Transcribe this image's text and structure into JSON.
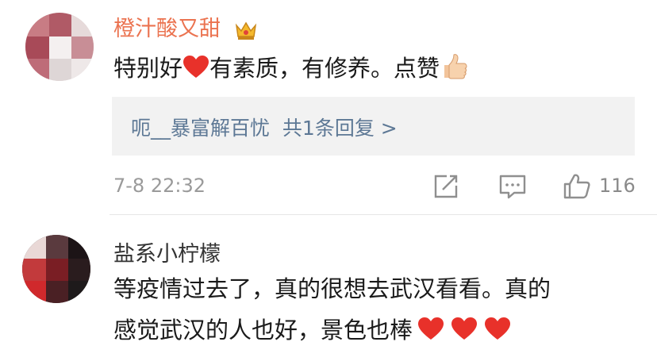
{
  "comments": [
    {
      "username": "橙汁酸又甜",
      "has_crown_badge": true,
      "text_before": "特别好",
      "text_after": "有素质，有修养。点赞",
      "reply": {
        "user": "呃__暴富解百忧",
        "summary": "共1条回复 >"
      },
      "timestamp": "7-8 22:32",
      "like_count": "116"
    },
    {
      "username": "盐系小柠檬",
      "line1": "等疫情过去了，真的很想去武汉看看。真的",
      "line2": "感觉武汉的人也好，景色也棒"
    }
  ],
  "colors": {
    "username_highlight": "#eb7350",
    "reply_link": "#5d7895",
    "heart": "#e8312a",
    "meta_gray": "#9a9a9a"
  },
  "icons": [
    "crown-icon",
    "heart-emoji-icon",
    "thumbs-up-emoji-icon",
    "share-icon",
    "comment-icon",
    "like-icon"
  ]
}
